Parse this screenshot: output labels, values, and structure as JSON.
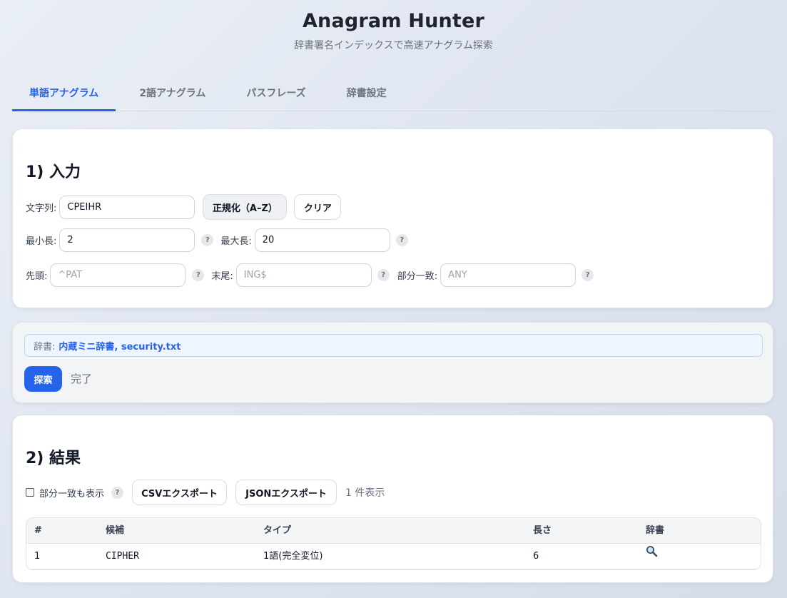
{
  "app": {
    "title": "Anagram Hunter",
    "subtitle": "辞書署名インデックスで高速アナグラム探索"
  },
  "tabs": [
    {
      "label": "単語アナグラム",
      "active": true
    },
    {
      "label": "2語アナグラム",
      "active": false
    },
    {
      "label": "パスフレーズ",
      "active": false
    },
    {
      "label": "辞書設定",
      "active": false
    }
  ],
  "input": {
    "title": "1) 入力",
    "string_label": "文字列:",
    "string_value": "CPEIHR",
    "normalize_button": "正規化（A–Z）",
    "clear_button": "クリア",
    "min_label": "最小長:",
    "min_value": "2",
    "max_label": "最大長:",
    "max_value": "20",
    "prefix_label": "先頭:",
    "prefix_placeholder": "^PAT",
    "suffix_label": "末尾:",
    "suffix_placeholder": "ING$",
    "partial_label": "部分一致:",
    "partial_placeholder": "ANY",
    "help_mark": "?"
  },
  "search": {
    "dict_label": "辞書:",
    "dict_names": "内蔵ミニ辞書, security.txt",
    "button": "探索",
    "status": "完了"
  },
  "results": {
    "title": "2) 結果",
    "show_partial_label": "部分一致も表示",
    "show_partial_checked": false,
    "csv_button": "CSVエクスポート",
    "json_button": "JSONエクスポート",
    "count_text": "1 件表示",
    "columns": [
      "#",
      "候補",
      "タイプ",
      "長さ",
      "辞書"
    ],
    "rows": [
      {
        "index": "1",
        "candidate": "CIPHER",
        "type": "1語(完全変位)",
        "length": "6",
        "dict_icon": "magnifier-icon"
      }
    ]
  },
  "colors": {
    "accent": "#2563eb",
    "background": "#e3e8f1",
    "card": "#ffffff"
  }
}
